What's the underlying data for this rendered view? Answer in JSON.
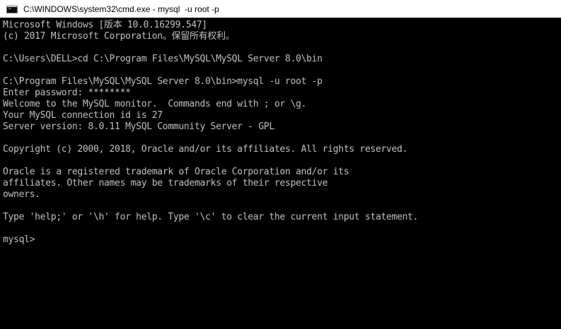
{
  "window": {
    "title": "C:\\WINDOWS\\system32\\cmd.exe - mysql  -u root -p",
    "icon": "command-prompt-icon",
    "colors": {
      "title_background": "#ffffff",
      "console_background": "#000000",
      "console_text": "#c0c0c0"
    }
  },
  "console": {
    "lines": [
      "Microsoft Windows [版本 10.0.16299.547]",
      "(c) 2017 Microsoft Corporation。保留所有权利。",
      "",
      "C:\\Users\\DELL>cd C:\\Program Files\\MySQL\\MySQL Server 8.0\\bin",
      "",
      "C:\\Program Files\\MySQL\\MySQL Server 8.0\\bin>mysql -u root -p",
      "Enter password: ********",
      "Welcome to the MySQL monitor.  Commands end with ; or \\g.",
      "Your MySQL connection id is 27",
      "Server version: 8.0.11 MySQL Community Server - GPL",
      "",
      "Copyright (c) 2000, 2018, Oracle and/or its affiliates. All rights reserved.",
      "",
      "Oracle is a registered trademark of Oracle Corporation and/or its",
      "affiliates. Other names may be trademarks of their respective",
      "owners.",
      "",
      "Type 'help;' or '\\h' for help. Type '\\c' to clear the current input statement.",
      "",
      "mysql>"
    ]
  }
}
